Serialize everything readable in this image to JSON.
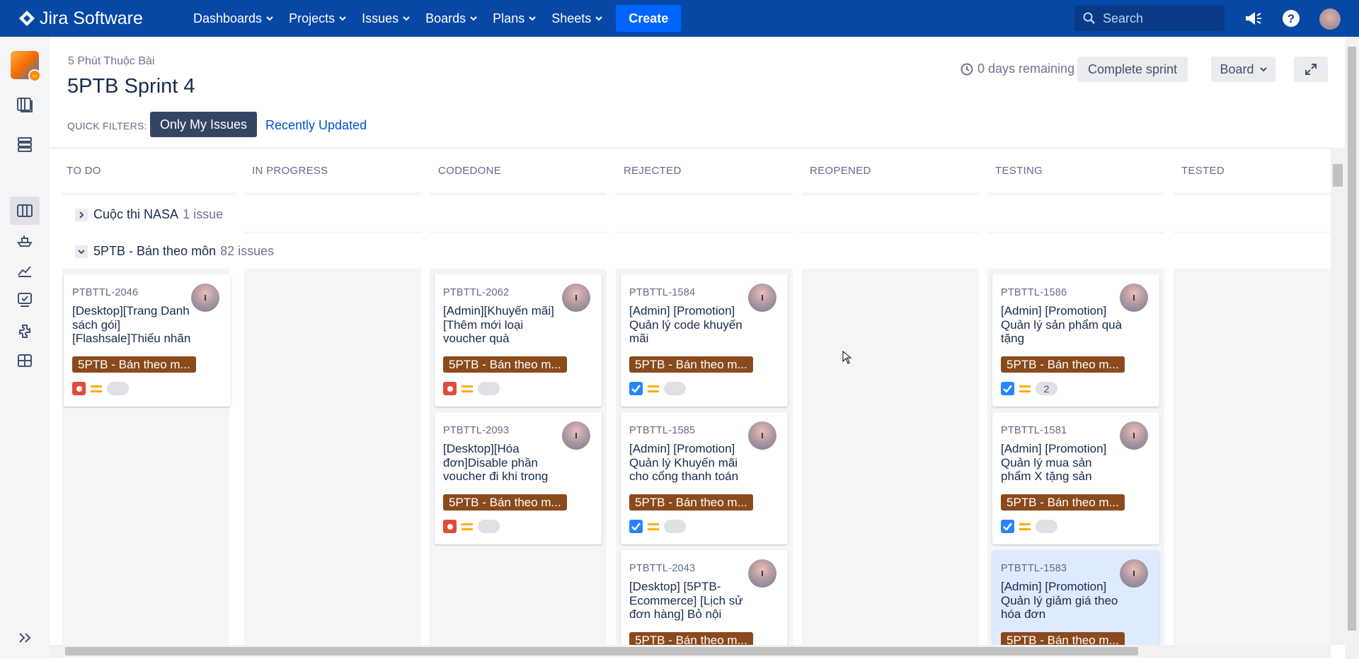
{
  "topnav": {
    "brand": "Jira Software",
    "items": [
      {
        "label": "Dashboards"
      },
      {
        "label": "Projects"
      },
      {
        "label": "Issues"
      },
      {
        "label": "Boards"
      },
      {
        "label": "Plans"
      },
      {
        "label": "Sheets"
      }
    ],
    "create_label": "Create",
    "search_placeholder": "Search"
  },
  "sidebar": {
    "icons": [
      "roadmap-icon",
      "backlog-icon",
      "board-icon",
      "releases-icon",
      "reports-icon",
      "tests-icon",
      "addons-icon",
      "apps-icon",
      "expand-icon"
    ]
  },
  "header": {
    "project_name": "5 Phút Thuộc Bài",
    "sprint_title": "5PTB Sprint 4",
    "days_remaining": "0 days remaining",
    "complete_sprint": "Complete sprint",
    "board_menu": "Board"
  },
  "quick_filters": {
    "label": "QUICK FILTERS:",
    "active": "Only My Issues",
    "link": "Recently Updated"
  },
  "columns": [
    "TO DO",
    "IN PROGRESS",
    "CODEDONE",
    "REJECTED",
    "REOPENED",
    "TESTING",
    "TESTED"
  ],
  "swimlanes": [
    {
      "name": "Cuộc thi NASA",
      "count": "1 issue",
      "expanded": false
    },
    {
      "name": "5PTB - Bán theo môn",
      "count": "82 issues",
      "expanded": true
    }
  ],
  "cards": [
    {
      "key": "PTBTTL-2046",
      "summary": "[Desktop][Trang Danh sách gói][Flashsale]Thiếu nhãn",
      "epic": "5PTB - Bán theo m...",
      "type": "bug",
      "estimate": ""
    },
    {
      "key": "PTBTTL-2062",
      "summary": "[Admin][Khuyến mãi][Thêm mới loại voucher quà",
      "epic": "5PTB - Bán theo m...",
      "type": "bug",
      "estimate": ""
    },
    {
      "key": "PTBTTL-2093",
      "summary": "[Desktop][Hóa đơn]Disable phần voucher đi khi trong",
      "epic": "5PTB - Bán theo m...",
      "type": "bug",
      "estimate": ""
    },
    {
      "key": "PTBTTL-1584",
      "summary": "[Admin] [Promotion] Quản lý code khuyến mãi",
      "epic": "5PTB - Bán theo m...",
      "type": "task",
      "estimate": ""
    },
    {
      "key": "PTBTTL-1585",
      "summary": "[Admin] [Promotion] Quản lý Khuyến mãi cho cổng thanh toán",
      "epic": "5PTB - Bán theo m...",
      "type": "task",
      "estimate": ""
    },
    {
      "key": "PTBTTL-2043",
      "summary": "[Desktop] [5PTB-Ecommerce] [Lịch sử đơn hàng] Bỏ nội",
      "epic": "5PTB - Bán theo m...",
      "type": "task",
      "estimate": ""
    },
    {
      "key": "PTBTTL-1586",
      "summary": "[Admin] [Promotion] Quản lý sản phẩm quà tặng",
      "epic": "5PTB - Bán theo m...",
      "type": "task",
      "estimate": "2"
    },
    {
      "key": "PTBTTL-1581",
      "summary": "[Admin] [Promotion] Quản lý mua sản phẩm X tặng sản",
      "epic": "5PTB - Bán theo m...",
      "type": "task",
      "estimate": ""
    },
    {
      "key": "PTBTTL-1583",
      "summary": "[Admin] [Promotion] Quản lý giảm giá theo hóa đơn",
      "epic": "5PTB - Bán theo m...",
      "type": "task",
      "estimate": ""
    }
  ],
  "colors": {
    "nav": "#0747a6",
    "create": "#0065ff",
    "epic": "#8a4a1c",
    "bug": "#e5493a",
    "task": "#2684ff",
    "priority": "#ffab00"
  }
}
